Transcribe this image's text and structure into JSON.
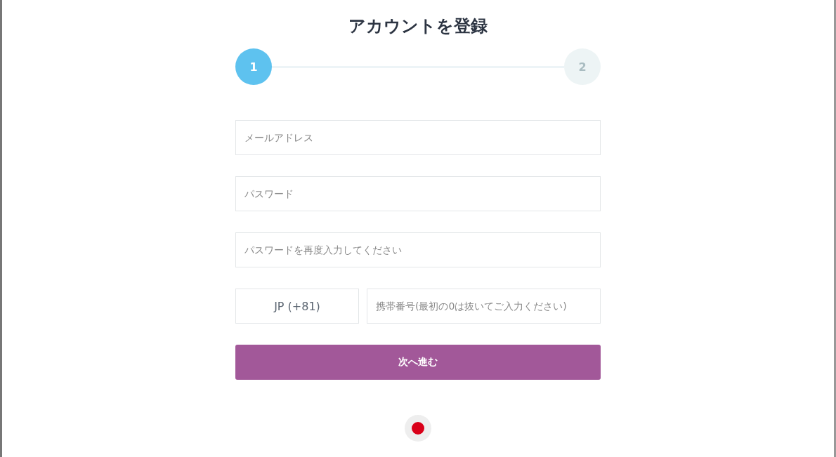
{
  "title": "アカウントを登録",
  "steps": [
    {
      "label": "1",
      "selected": true
    },
    {
      "label": "2",
      "selected": false
    }
  ],
  "fields": [
    {
      "placeholder": "メールアドレス"
    },
    {
      "placeholder": "パスワード"
    },
    {
      "placeholder": "パスワードを再度入力してください"
    }
  ],
  "phone": {
    "country": "JP (+81)",
    "placeholder": "携帯番号(最初の0は抜いてご入力ください)"
  },
  "submit": "次へ進む"
}
